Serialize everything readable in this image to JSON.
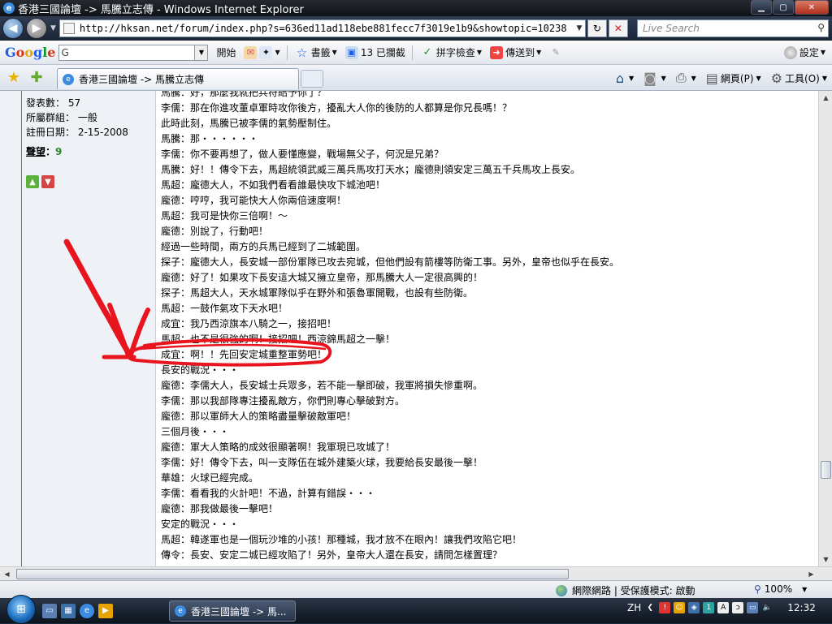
{
  "window": {
    "title": "香港三國論壇 -> 馬騰立志傳 - Windows Internet Explorer",
    "url": "http://hksan.net/forum/index.php?s=636ed11ad118ebe881fecc7f3019e1b9&showtopic=10238",
    "search_placeholder": "Live Search"
  },
  "google_toolbar": {
    "logo": "Google",
    "search_value": "G",
    "start_label": "開始",
    "bookmarks_label": "書籤",
    "blocked_label": "13 已攔截",
    "spellcheck_label": "拼字檢查",
    "send_label": "傳送到",
    "settings_label": "設定"
  },
  "tab": {
    "label": "香港三國論壇 -> 馬騰立志傳"
  },
  "command_bar": {
    "page_label": "網頁(P)",
    "tools_label": "工具(O)"
  },
  "user_info": {
    "posts": "發表數：  57",
    "group": "所屬群組：  一般",
    "joined": "註冊日期：  2-15-2008",
    "reputation_label": "聲望",
    "reputation_sep": "：",
    "reputation_value": "9"
  },
  "post_lines": [
    "馬騰：好，那麼我就把兵符給予你了？",
    "李儒：那在你進攻董卓軍時攻你後方，擾亂大人你的後防的人都算是你兄長嗎！？",
    "此時此刻，馬騰已被李儒的氣勢壓制住。",
    "馬騰：那・・・・・・",
    "李儒：你不要再想了，做人要懂應變，戰場無父子，何況是兄弟？",
    "馬騰：好！！傳令下去，馬超統領武威三萬兵馬攻打天水；龐德則領安定三萬五千兵馬攻上長安。",
    "馬超：龐德大人，不如我們看看誰最快攻下城池吧！",
    "龐德：哼哼，我可能快大人你兩倍速度啊！",
    "馬超：我可是快你三倍啊！～",
    "龐德：別說了，行動吧！",
    "經過一些時間，兩方的兵馬已經到了二城範圍。",
    "探子：龐德大人，長安城一部份軍隊已攻去宛城，但他們設有箭樓等防衛工事。另外，皇帝也似乎在長安。",
    "龐德：好了！如果攻下長安這大城又擁立皇帝，那馬騰大人一定很高興的！",
    "探子：馬超大人，天水城軍隊似乎在野外和張魯軍開戰，也設有些防衛。",
    "馬超：一鼓作氣攻下天水吧！",
    "成宜：我乃西涼旗本八騎之一，接招吧！",
    "馬超：也不是很強的啊！接招吧！西涼錦馬超之一擊！",
    "成宜：啊！！先回安定城重整軍勢吧！",
    "長安的戰況・・・",
    "龐德：李儒大人，長安城士兵眾多，若不能一擊即破，我軍將損失慘重啊。",
    "李儒：那以我部隊專注擾亂敵方，你們則專心擊破對方。",
    "龐德：那以軍師大人的策略盡量擊破敵軍吧！",
    "三個月後・・・",
    "龐德：軍大人策略的成效很顯著啊！我軍現已攻城了！",
    "李儒：好！傳令下去，叫一支隊伍在城外建築火球，我要給長安最後一擊！",
    "華雄：火球已經完成。",
    "李儒：看看我的火計吧！不過，計算有錯誤・・・",
    "龐德：那我做最後一擊吧！",
    "安定的戰況・・・",
    "馬超：韓遂軍也是一個玩沙堆的小孩！那種城，我才放不在眼內！讓我們攻陷它吧！",
    "傳令：長安、安定二城已經攻陷了！另外，皇帝大人還在長安，請問怎樣置理？"
  ],
  "status_bar": {
    "zone": "網際網路 | 受保護模式: 啟動",
    "zoom": "100%"
  },
  "taskbar": {
    "task_label": "香港三國論壇 -> 馬...",
    "lang": "ZH",
    "time": "12:32"
  },
  "colors": {
    "annotation": "#e8141e",
    "reputation": "#2a8a2a"
  }
}
